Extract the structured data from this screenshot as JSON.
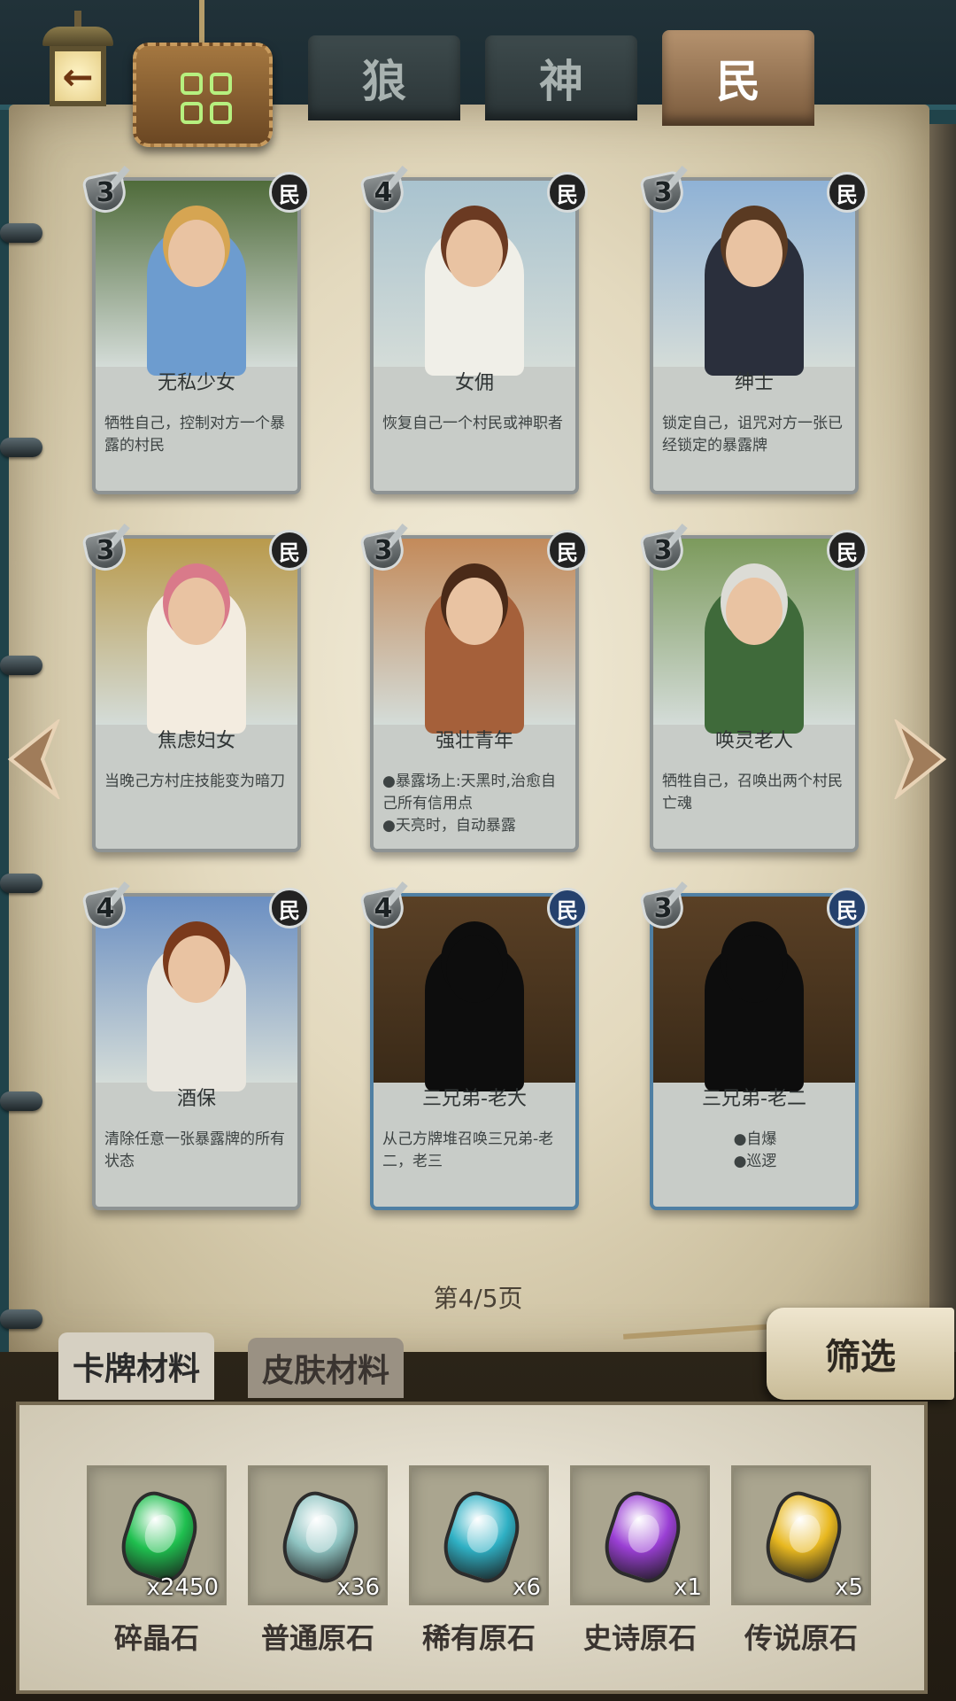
{
  "tabs": [
    {
      "label": "狼",
      "active": false
    },
    {
      "label": "神",
      "active": false
    },
    {
      "label": "民",
      "active": true
    }
  ],
  "back_icon": "back-arrow-icon",
  "menu_icon": "grid-menu-icon",
  "cards": [
    {
      "cost": "3",
      "faction": "民",
      "name": "无私少女",
      "desc": [
        "牺牲自己，控制对方一个暴露的村民"
      ],
      "revealed": true,
      "colors": {
        "bg": "#4f6b3a",
        "figure": "#6d9ccf",
        "hair": "#d6a552"
      }
    },
    {
      "cost": "4",
      "faction": "民",
      "name": "女佣",
      "desc": [
        "恢复自己一个村民或神职者"
      ],
      "revealed": true,
      "colors": {
        "bg": "#a9c3cf",
        "figure": "#f0efe8",
        "hair": "#6b3a22"
      }
    },
    {
      "cost": "3",
      "faction": "民",
      "name": "绅士",
      "desc": [
        "锁定自己，诅咒对方一张已经锁定的暴露牌"
      ],
      "revealed": true,
      "colors": {
        "bg": "#8fb2d6",
        "figure": "#2a2f3c",
        "hair": "#5a3a22"
      }
    },
    {
      "cost": "3",
      "faction": "民",
      "name": "焦虑妇女",
      "desc": [
        "当晚己方村庄技能变为暗刀"
      ],
      "revealed": true,
      "colors": {
        "bg": "#b99a4c",
        "figure": "#f3ece0",
        "hair": "#d97a8a"
      }
    },
    {
      "cost": "3",
      "faction": "民",
      "name": "强壮青年",
      "desc": [
        "●暴露场上:天黑时,治愈自己所有信用点",
        "●天亮时，自动暴露"
      ],
      "revealed": true,
      "colors": {
        "bg": "#c38a5a",
        "figure": "#a5603a",
        "hair": "#4a2a18"
      }
    },
    {
      "cost": "3",
      "faction": "民",
      "name": "唤灵老人",
      "desc": [
        "牺牲自己，召唤出两个村民亡魂"
      ],
      "revealed": true,
      "colors": {
        "bg": "#7c9a5c",
        "figure": "#3f6a3a",
        "hair": "#dcdcd6"
      }
    },
    {
      "cost": "4",
      "faction": "民",
      "name": "酒保",
      "desc": [
        "清除任意一张暴露牌的所有状态"
      ],
      "revealed": true,
      "colors": {
        "bg": "#6b8fc2",
        "figure": "#e9e6de",
        "hair": "#7a3a1c"
      }
    },
    {
      "cost": "4",
      "faction": "民",
      "name": "三兄弟-老大",
      "desc": [
        "从己方牌堆召唤三兄弟-老二，老三"
      ],
      "revealed": false,
      "colors": {
        "bg": "#5a4025",
        "figure": "#0d0d0d",
        "hair": "#0d0d0d"
      }
    },
    {
      "cost": "3",
      "faction": "民",
      "name": "三兄弟-老二",
      "desc": [
        "●自爆",
        "●巡逻"
      ],
      "revealed": false,
      "colors": {
        "bg": "#5a4025",
        "figure": "#0d0d0d",
        "hair": "#0d0d0d"
      }
    }
  ],
  "page_indicator": "第4/5页",
  "prev_icon": "chevron-left-icon",
  "next_icon": "chevron-right-icon",
  "material_tabs": [
    {
      "label": "卡牌材料",
      "active": true
    },
    {
      "label": "皮肤材料",
      "active": false
    }
  ],
  "filter_label": "筛选",
  "materials": [
    {
      "name": "碎晶石",
      "count": "x2450",
      "color": "#1fbf4f"
    },
    {
      "name": "普通原石",
      "count": "x36",
      "color": "#8fc4c2"
    },
    {
      "name": "稀有原石",
      "count": "x6",
      "color": "#2fb0c4"
    },
    {
      "name": "史诗原石",
      "count": "x1",
      "color": "#9a3fd4"
    },
    {
      "name": "传说原石",
      "count": "x5",
      "color": "#e8b820"
    }
  ]
}
